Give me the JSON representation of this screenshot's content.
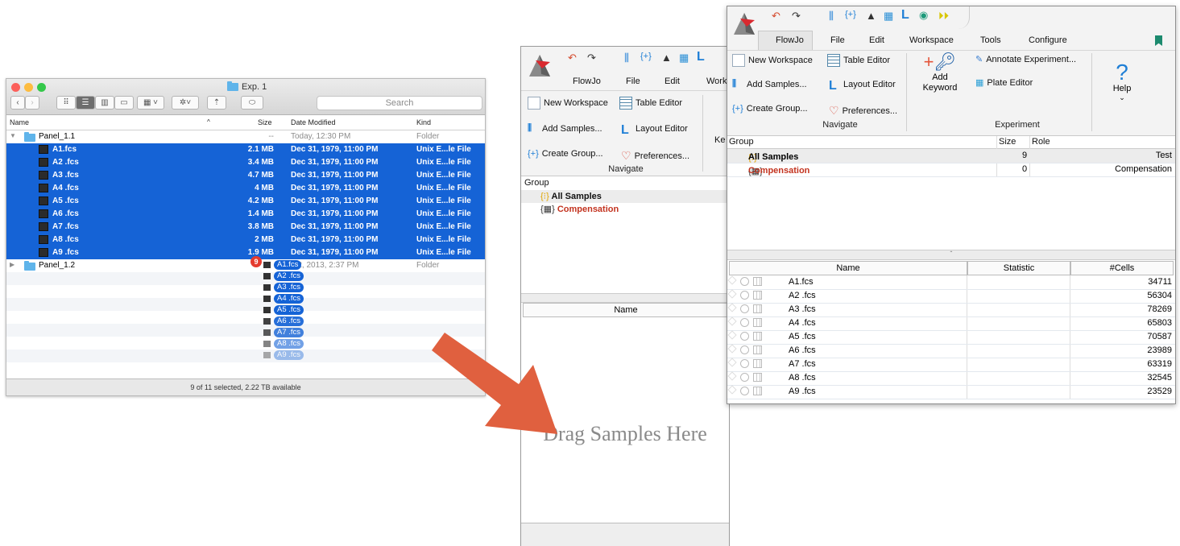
{
  "finder": {
    "title": "Exp. 1",
    "search_placeholder": "Search",
    "columns": {
      "name": "Name",
      "size": "Size",
      "date": "Date Modified",
      "kind": "Kind"
    },
    "rows": [
      {
        "name": "Panel_1.1",
        "size": "--",
        "date": "Today, 12:30 PM",
        "kind": "Folder"
      },
      {
        "name": "A1.fcs",
        "size": "2.1 MB",
        "date": "Dec 31, 1979, 11:00 PM",
        "kind": "Unix E...le File"
      },
      {
        "name": "A2 .fcs",
        "size": "3.4 MB",
        "date": "Dec 31, 1979, 11:00 PM",
        "kind": "Unix E...le File"
      },
      {
        "name": "A3 .fcs",
        "size": "4.7 MB",
        "date": "Dec 31, 1979, 11:00 PM",
        "kind": "Unix E...le File"
      },
      {
        "name": "A4 .fcs",
        "size": "4 MB",
        "date": "Dec 31, 1979, 11:00 PM",
        "kind": "Unix E...le File"
      },
      {
        "name": "A5 .fcs",
        "size": "4.2 MB",
        "date": "Dec 31, 1979, 11:00 PM",
        "kind": "Unix E...le File"
      },
      {
        "name": "A6 .fcs",
        "size": "1.4 MB",
        "date": "Dec 31, 1979, 11:00 PM",
        "kind": "Unix E...le File"
      },
      {
        "name": "A7 .fcs",
        "size": "3.8 MB",
        "date": "Dec 31, 1979, 11:00 PM",
        "kind": "Unix E...le File"
      },
      {
        "name": "A8 .fcs",
        "size": "2 MB",
        "date": "Dec 31, 1979, 11:00 PM",
        "kind": "Unix E...le File"
      },
      {
        "name": "A9 .fcs",
        "size": "1.9 MB",
        "date": "Dec 31, 1979, 11:00 PM",
        "kind": "Unix E...le File"
      },
      {
        "name": "Panel_1.2",
        "size": "",
        "date": "...2, 2013, 2:37 PM",
        "kind": "Folder"
      }
    ],
    "drag_badge": "9",
    "drag_items": [
      "A1.fcs",
      "A2 .fcs",
      "A3 .fcs",
      "A4 .fcs",
      "A5 .fcs",
      "A6 .fcs",
      "A7 .fcs",
      "A8 .fcs",
      "A9 .fcs"
    ],
    "status": "9 of 11 selected, 2.22 TB available"
  },
  "flowjo_back": {
    "menus": [
      "FlowJo",
      "File",
      "Edit",
      "Work"
    ],
    "buttons": {
      "new_workspace": "New Workspace",
      "table_editor": "Table Editor",
      "add_samples": "Add Samples...",
      "layout_editor": "Layout Editor",
      "create_group": "Create Group...",
      "preferences": "Preferences...",
      "ke": "Ke"
    },
    "navigate_label": "Navigate",
    "group_header": "Group",
    "groups": [
      "All Samples",
      "Compensation"
    ],
    "name_header": "Name",
    "drop_hint": "Drag Samples Here"
  },
  "flowjo_front": {
    "menus": [
      "FlowJo",
      "File",
      "Edit",
      "Workspace",
      "Tools",
      "Configure"
    ],
    "buttons": {
      "new_workspace": "New Workspace",
      "table_editor": "Table Editor",
      "add_samples": "Add Samples...",
      "layout_editor": "Layout Editor",
      "create_group": "Create Group...",
      "preferences": "Preferences...",
      "add_keyword": "Add Keyword",
      "annotate": "Annotate Experiment...",
      "plate_editor": "Plate Editor",
      "help": "Help"
    },
    "navigate_label": "Navigate",
    "experiment_label": "Experiment",
    "group_columns": {
      "group": "Group",
      "size": "Size",
      "role": "Role"
    },
    "groups": [
      {
        "name": "All Samples",
        "size": "9",
        "role": "Test"
      },
      {
        "name": "Compensation",
        "size": "0",
        "role": "Compensation"
      }
    ],
    "sample_columns": {
      "name": "Name",
      "statistic": "Statistic",
      "cells": "#Cells"
    },
    "samples": [
      {
        "name": "A1.fcs",
        "cells": "34711"
      },
      {
        "name": "A2 .fcs",
        "cells": "56304"
      },
      {
        "name": "A3 .fcs",
        "cells": "78269"
      },
      {
        "name": "A4 .fcs",
        "cells": "65803"
      },
      {
        "name": "A5 .fcs",
        "cells": "70587"
      },
      {
        "name": "A6 .fcs",
        "cells": "23989"
      },
      {
        "name": "A7 .fcs",
        "cells": "63319"
      },
      {
        "name": "A8 .fcs",
        "cells": "32545"
      },
      {
        "name": "A9 .fcs",
        "cells": "23529"
      }
    ]
  },
  "colors": {
    "selection": "#1563d6",
    "arrow": "#e0603f",
    "compensation": "#c3331f"
  }
}
